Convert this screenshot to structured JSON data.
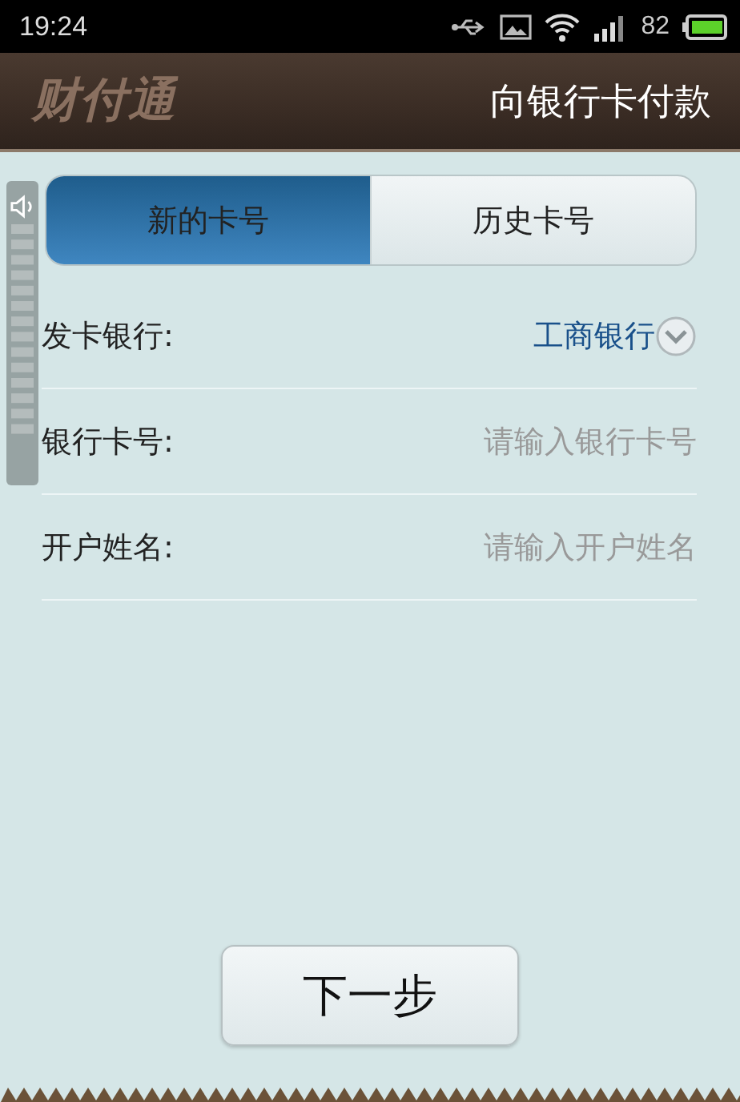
{
  "status_bar": {
    "time": "19:24",
    "battery": "82"
  },
  "header": {
    "logo": "财付通",
    "title": "向银行卡付款"
  },
  "tabs": [
    {
      "label": "新的卡号",
      "selected": true
    },
    {
      "label": "历史卡号",
      "selected": false
    }
  ],
  "form": [
    {
      "kind": "select",
      "label": "发卡银行:",
      "value": "工商银行"
    },
    {
      "kind": "input",
      "label": "银行卡号:",
      "placeholder": "请输入银行卡号"
    },
    {
      "kind": "input",
      "label": "开户姓名:",
      "placeholder": "请输入开户姓名"
    }
  ],
  "next_button": "下一步"
}
